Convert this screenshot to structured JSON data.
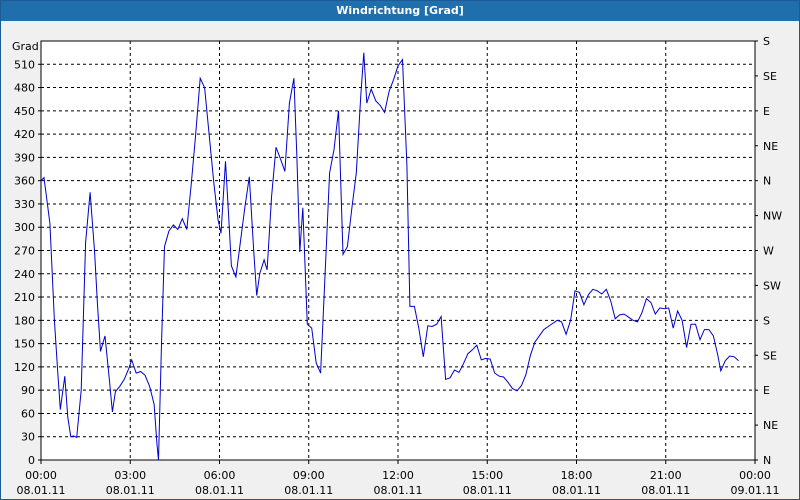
{
  "window": {
    "title": "Windrichtung [Grad]"
  },
  "chart_data": {
    "type": "line",
    "title": "Windrichtung [Grad]",
    "ylabel": "Grad",
    "ylim": [
      0,
      540
    ],
    "yticks": [
      0,
      30,
      60,
      90,
      120,
      150,
      180,
      210,
      240,
      270,
      300,
      330,
      360,
      390,
      420,
      450,
      480,
      510
    ],
    "right_axis_labels": [
      {
        "value": 0,
        "label": "N"
      },
      {
        "value": 45,
        "label": "NE"
      },
      {
        "value": 90,
        "label": "E"
      },
      {
        "value": 135,
        "label": "SE"
      },
      {
        "value": 180,
        "label": "S"
      },
      {
        "value": 225,
        "label": "SW"
      },
      {
        "value": 270,
        "label": "W"
      },
      {
        "value": 315,
        "label": "NW"
      },
      {
        "value": 360,
        "label": "N"
      },
      {
        "value": 405,
        "label": "NE"
      },
      {
        "value": 450,
        "label": "E"
      },
      {
        "value": 495,
        "label": "SE"
      },
      {
        "value": 540,
        "label": "S"
      }
    ],
    "x_range_hours": [
      0,
      24
    ],
    "x_ticks": [
      {
        "hour": 0,
        "time": "00:00",
        "date": "08.01.11"
      },
      {
        "hour": 3,
        "time": "03:00",
        "date": "08.01.11"
      },
      {
        "hour": 6,
        "time": "06:00",
        "date": "08.01.11"
      },
      {
        "hour": 9,
        "time": "09:00",
        "date": "08.01.11"
      },
      {
        "hour": 12,
        "time": "12:00",
        "date": "08.01.11"
      },
      {
        "hour": 15,
        "time": "15:00",
        "date": "08.01.11"
      },
      {
        "hour": 18,
        "time": "18:00",
        "date": "08.01.11"
      },
      {
        "hour": 21,
        "time": "21:00",
        "date": "08.01.11"
      },
      {
        "hour": 24,
        "time": "00:00",
        "date": "09.01.11"
      }
    ],
    "grid": true,
    "series": [
      {
        "color": "#0000cc",
        "points": [
          [
            0.0,
            360
          ],
          [
            0.1,
            364
          ],
          [
            0.3,
            305
          ],
          [
            0.45,
            180
          ],
          [
            0.55,
            120
          ],
          [
            0.65,
            65
          ],
          [
            0.8,
            108
          ],
          [
            0.9,
            55
          ],
          [
            1.0,
            30
          ],
          [
            1.1,
            31
          ],
          [
            1.2,
            29
          ],
          [
            1.35,
            90
          ],
          [
            1.5,
            280
          ],
          [
            1.65,
            345
          ],
          [
            1.8,
            270
          ],
          [
            1.9,
            200
          ],
          [
            2.0,
            140
          ],
          [
            2.15,
            160
          ],
          [
            2.3,
            103
          ],
          [
            2.4,
            62
          ],
          [
            2.5,
            88
          ],
          [
            2.65,
            95
          ],
          [
            2.8,
            104
          ],
          [
            2.95,
            118
          ],
          [
            3.05,
            129
          ],
          [
            3.2,
            112
          ],
          [
            3.35,
            114
          ],
          [
            3.5,
            109
          ],
          [
            3.65,
            95
          ],
          [
            3.8,
            72
          ],
          [
            3.9,
            20
          ],
          [
            3.95,
            0
          ],
          [
            4.05,
            150
          ],
          [
            4.15,
            275
          ],
          [
            4.3,
            295
          ],
          [
            4.45,
            303
          ],
          [
            4.6,
            297
          ],
          [
            4.75,
            311
          ],
          [
            4.9,
            297
          ],
          [
            5.05,
            355
          ],
          [
            5.2,
            420
          ],
          [
            5.35,
            492
          ],
          [
            5.5,
            480
          ],
          [
            5.65,
            420
          ],
          [
            5.8,
            360
          ],
          [
            5.95,
            310
          ],
          [
            6.05,
            292
          ],
          [
            6.2,
            385
          ],
          [
            6.3,
            320
          ],
          [
            6.4,
            250
          ],
          [
            6.55,
            236
          ],
          [
            6.7,
            280
          ],
          [
            6.85,
            325
          ],
          [
            7.0,
            365
          ],
          [
            7.15,
            270
          ],
          [
            7.25,
            212
          ],
          [
            7.35,
            240
          ],
          [
            7.5,
            258
          ],
          [
            7.6,
            245
          ],
          [
            7.75,
            340
          ],
          [
            7.9,
            403
          ],
          [
            8.05,
            388
          ],
          [
            8.2,
            372
          ],
          [
            8.35,
            460
          ],
          [
            8.5,
            492
          ],
          [
            8.6,
            390
          ],
          [
            8.7,
            268
          ],
          [
            8.8,
            325
          ],
          [
            8.95,
            175
          ],
          [
            9.1,
            170
          ],
          [
            9.25,
            125
          ],
          [
            9.4,
            112
          ],
          [
            9.55,
            240
          ],
          [
            9.7,
            370
          ],
          [
            9.85,
            400
          ],
          [
            10.0,
            450
          ],
          [
            10.15,
            265
          ],
          [
            10.3,
            275
          ],
          [
            10.45,
            325
          ],
          [
            10.6,
            370
          ],
          [
            10.75,
            470
          ],
          [
            10.85,
            525
          ],
          [
            10.95,
            460
          ],
          [
            11.1,
            478
          ],
          [
            11.25,
            463
          ],
          [
            11.4,
            457
          ],
          [
            11.55,
            448
          ],
          [
            11.7,
            475
          ],
          [
            11.85,
            490
          ],
          [
            12.0,
            508
          ],
          [
            12.15,
            516
          ],
          [
            12.3,
            380
          ],
          [
            12.4,
            198
          ],
          [
            12.55,
            198
          ],
          [
            12.7,
            170
          ],
          [
            12.85,
            133
          ],
          [
            13.0,
            173
          ],
          [
            13.15,
            172
          ],
          [
            13.3,
            175
          ],
          [
            13.45,
            185
          ],
          [
            13.6,
            104
          ],
          [
            13.75,
            106
          ],
          [
            13.9,
            116
          ],
          [
            14.05,
            113
          ],
          [
            14.2,
            124
          ],
          [
            14.35,
            137
          ],
          [
            14.5,
            142
          ],
          [
            14.65,
            148
          ],
          [
            14.8,
            129
          ],
          [
            14.95,
            131
          ],
          [
            15.1,
            130
          ],
          [
            15.25,
            112
          ],
          [
            15.4,
            108
          ],
          [
            15.55,
            107
          ],
          [
            15.7,
            100
          ],
          [
            15.85,
            92
          ],
          [
            16.0,
            89
          ],
          [
            16.15,
            96
          ],
          [
            16.3,
            110
          ],
          [
            16.45,
            135
          ],
          [
            16.6,
            152
          ],
          [
            16.75,
            160
          ],
          [
            16.9,
            168
          ],
          [
            17.05,
            172
          ],
          [
            17.2,
            176
          ],
          [
            17.35,
            180
          ],
          [
            17.5,
            178
          ],
          [
            17.65,
            162
          ],
          [
            17.8,
            180
          ],
          [
            17.95,
            218
          ],
          [
            18.1,
            216
          ],
          [
            18.25,
            200
          ],
          [
            18.4,
            213
          ],
          [
            18.55,
            220
          ],
          [
            18.7,
            218
          ],
          [
            18.85,
            214
          ],
          [
            19.0,
            220
          ],
          [
            19.15,
            205
          ],
          [
            19.3,
            182
          ],
          [
            19.45,
            187
          ],
          [
            19.6,
            188
          ],
          [
            19.75,
            184
          ],
          [
            19.9,
            180
          ],
          [
            20.05,
            178
          ],
          [
            20.2,
            190
          ],
          [
            20.35,
            208
          ],
          [
            20.5,
            203
          ],
          [
            20.65,
            188
          ],
          [
            20.8,
            196
          ],
          [
            20.95,
            195
          ],
          [
            21.1,
            196
          ],
          [
            21.25,
            170
          ],
          [
            21.4,
            192
          ],
          [
            21.55,
            180
          ],
          [
            21.7,
            145
          ],
          [
            21.85,
            175
          ],
          [
            22.0,
            175
          ],
          [
            22.15,
            155
          ],
          [
            22.3,
            168
          ],
          [
            22.45,
            168
          ],
          [
            22.6,
            160
          ],
          [
            22.75,
            135
          ],
          [
            22.85,
            115
          ],
          [
            23.0,
            128
          ],
          [
            23.15,
            134
          ],
          [
            23.3,
            133
          ],
          [
            23.45,
            128
          ]
        ]
      }
    ]
  }
}
